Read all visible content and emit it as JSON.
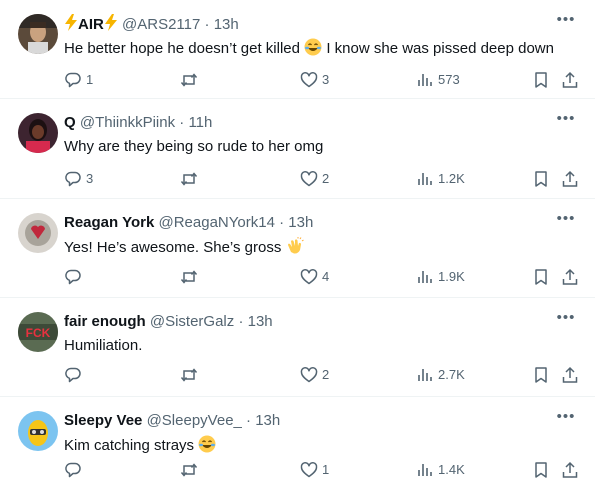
{
  "colors": {
    "text_primary": "#0f1419",
    "text_secondary": "#536471",
    "divider": "#eff3f4",
    "lightning": "#f7b500"
  },
  "tweets": [
    {
      "name_main": "AIR",
      "name_decor_icon": "lightning-bolt-icon",
      "handle": "@ARS2117",
      "time": "13h",
      "text_before_emoji": "He better hope he doesn’t get killed ",
      "emoji": "face-with-tears-of-joy",
      "text_after_emoji": " I know she was pissed deep down",
      "replies": "1",
      "retweets": "",
      "likes": "3",
      "views": "573"
    },
    {
      "name": "Q",
      "handle": "@ThiinkkPiink",
      "time": "11h",
      "text": "Why are they being so rude to her omg",
      "replies": "3",
      "retweets": "",
      "likes": "2",
      "views": "1.2K"
    },
    {
      "name": "Reagan York",
      "handle": "@ReagaNYork14",
      "time": "13h",
      "text": "Yes! He’s awesome. She’s gross",
      "emoji": "clapping-hands",
      "replies": "",
      "retweets": "",
      "likes": "4",
      "views": "1.9K"
    },
    {
      "name": "fair enough",
      "handle": "@SisterGalz",
      "time": "13h",
      "text": "Humiliation.",
      "avatar_text": "FCK",
      "replies": "",
      "retweets": "",
      "likes": "2",
      "views": "2.7K"
    },
    {
      "name": "Sleepy Vee",
      "handle": "@SleepyVee_",
      "time": "13h",
      "text": "Kim catching strays ",
      "emoji": "face-with-tears-of-joy",
      "replies": "",
      "retweets": "",
      "likes": "1",
      "views": "1.4K"
    }
  ],
  "icons": {
    "reply": "reply-icon",
    "retweet": "retweet-icon",
    "like": "heart-icon",
    "views": "views-chart-icon",
    "bookmark": "bookmark-icon",
    "share": "share-icon",
    "more": "more-icon"
  },
  "separator": "·",
  "more_glyph": "•••"
}
